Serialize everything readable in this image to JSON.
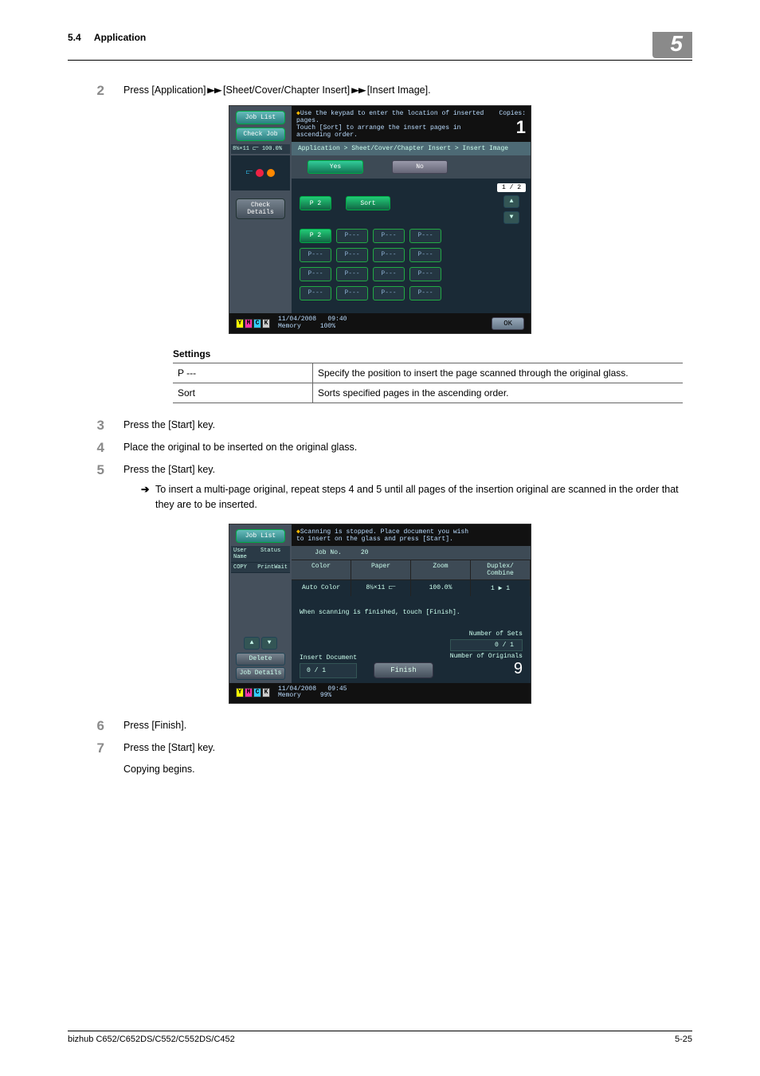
{
  "header": {
    "section": "5.4",
    "title": "Application",
    "chapter": "5"
  },
  "steps": {
    "s2": {
      "num": "2",
      "text_a": "Press [Application] ",
      "text_b": " [Sheet/Cover/Chapter Insert] ",
      "text_c": " [Insert Image]."
    },
    "s3": {
      "num": "3",
      "text": "Press the [Start] key."
    },
    "s4": {
      "num": "4",
      "text": "Place the original to be inserted on the original glass."
    },
    "s5": {
      "num": "5",
      "text": "Press the [Start] key.",
      "sub": "To insert a multi-page original, repeat steps 4 and 5 until all pages of the insertion original are scanned in the order that they are to be inserted."
    },
    "s6": {
      "num": "6",
      "text": "Press [Finish]."
    },
    "s7": {
      "num": "7",
      "text": "Press the [Start] key.",
      "line2": "Copying begins."
    }
  },
  "screen1": {
    "job_list": "Job List",
    "check_job": "Check Job",
    "side_info": "8½×11 ⫍   100.0%",
    "check_details": "Check Details",
    "msg1": "Use the keypad to enter the location of inserted pages.",
    "msg2": "Touch [Sort] to arrange the insert pages in ascending order.",
    "copies_lbl": "Copies:",
    "copies_val": "1",
    "crumb": "Application > Sheet/Cover/Chapter Insert > Insert Image",
    "yes": "Yes",
    "no": "No",
    "p2a": "P   2",
    "sort": "Sort",
    "p_sel": "P   2",
    "p_dim": "P---",
    "pager": "1 / 2",
    "ts_date": "11/04/2008",
    "ts_time": "09:40",
    "ts_mem": "Memory",
    "ts_memv": "100%",
    "ok": "OK",
    "toner": {
      "y": "Y",
      "m": "M",
      "c": "C",
      "k": "K"
    }
  },
  "screen2": {
    "job_list": "Job List",
    "user_name": "User\nName",
    "status": "Status",
    "copy": "COPY",
    "printwait": "PrintWait",
    "delete": "Delete",
    "job_details": "Job Details",
    "msg1": "Scanning is stopped. Place document you wish",
    "msg2": "to insert on the glass and press [Start].",
    "jobno_lbl": "Job No.",
    "jobno_val": "20",
    "h_color": "Color",
    "h_paper": "Paper",
    "h_zoom": "Zoom",
    "h_dc": "Duplex/\nCombine",
    "v_color": "Auto Color",
    "v_paper": "8½×11 ⫍",
    "v_zoom": "100.0%",
    "v_dc": "1 ▶ 1",
    "finmsg": "When scanning is finished, touch [Finish].",
    "ins_doc": "Insert Document",
    "ins_val": "0   /  1",
    "finish": "Finish",
    "sets_lbl": "Number of Sets",
    "sets_val": "0 / 1",
    "orig_lbl": "Number of Originals",
    "orig_val": "9",
    "ts_date": "11/04/2008",
    "ts_time": "09:45",
    "ts_mem": "Memory",
    "ts_memv": "99%"
  },
  "settings": {
    "title": "Settings",
    "r1": {
      "k": "P ---",
      "v": "Specify the position to insert the page scanned through the original glass."
    },
    "r2": {
      "k": "Sort",
      "v": "Sorts specified pages in the ascending order."
    }
  },
  "footer": {
    "model": "bizhub C652/C652DS/C552/C552DS/C452",
    "page": "5-25"
  }
}
